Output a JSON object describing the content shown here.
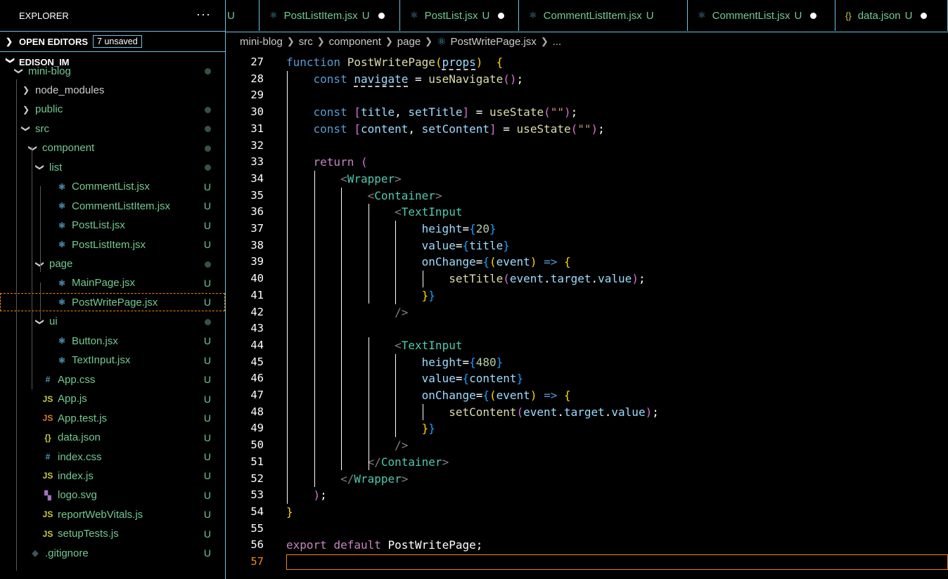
{
  "explorer": {
    "title": "EXPLORER",
    "more": "···",
    "open_editors_label": "OPEN EDITORS",
    "unsaved_badge": "7 unsaved",
    "workspace_label": "EDISON_IM"
  },
  "tree": [
    {
      "name": "mini-blog",
      "indent": 0,
      "type": "folder-open",
      "icon": "",
      "status": "dot"
    },
    {
      "name": "node_modules",
      "indent": 1,
      "type": "folder-closed",
      "icon": "",
      "status": ""
    },
    {
      "name": "public",
      "indent": 1,
      "type": "folder-closed",
      "icon": "",
      "status": "dot"
    },
    {
      "name": "src",
      "indent": 1,
      "type": "folder-open",
      "icon": "",
      "status": "dot"
    },
    {
      "name": "component",
      "indent": 2,
      "type": "folder-open",
      "icon": "",
      "status": "dot"
    },
    {
      "name": "list",
      "indent": 3,
      "type": "folder-open",
      "icon": "",
      "status": "dot"
    },
    {
      "name": "CommentList.jsx",
      "indent": 4,
      "type": "file",
      "icon": "react",
      "status": "U"
    },
    {
      "name": "CommentListItem.jsx",
      "indent": 4,
      "type": "file",
      "icon": "react",
      "status": "U"
    },
    {
      "name": "PostList.jsx",
      "indent": 4,
      "type": "file",
      "icon": "react",
      "status": "U"
    },
    {
      "name": "PostListItem.jsx",
      "indent": 4,
      "type": "file",
      "icon": "react",
      "status": "U"
    },
    {
      "name": "page",
      "indent": 3,
      "type": "folder-open",
      "icon": "",
      "status": "dot"
    },
    {
      "name": "MainPage.jsx",
      "indent": 4,
      "type": "file",
      "icon": "react",
      "status": "U"
    },
    {
      "name": "PostWritePage.jsx",
      "indent": 4,
      "type": "file",
      "icon": "react",
      "status": "U",
      "selected": true
    },
    {
      "name": "ui",
      "indent": 3,
      "type": "folder-open",
      "icon": "",
      "status": "dot"
    },
    {
      "name": "Button.jsx",
      "indent": 4,
      "type": "file",
      "icon": "react",
      "status": "U"
    },
    {
      "name": "TextInput.jsx",
      "indent": 4,
      "type": "file",
      "icon": "react",
      "status": "U"
    },
    {
      "name": "App.css",
      "indent": 2,
      "type": "file",
      "icon": "css",
      "status": "U"
    },
    {
      "name": "App.js",
      "indent": 2,
      "type": "file",
      "icon": "js",
      "status": "U"
    },
    {
      "name": "App.test.js",
      "indent": 2,
      "type": "file",
      "icon": "js-test",
      "status": "U"
    },
    {
      "name": "data.json",
      "indent": 2,
      "type": "file",
      "icon": "json",
      "status": "U"
    },
    {
      "name": "index.css",
      "indent": 2,
      "type": "file",
      "icon": "css",
      "status": "U"
    },
    {
      "name": "index.js",
      "indent": 2,
      "type": "file",
      "icon": "js",
      "status": "U"
    },
    {
      "name": "logo.svg",
      "indent": 2,
      "type": "file",
      "icon": "svg",
      "status": "U"
    },
    {
      "name": "reportWebVitals.js",
      "indent": 2,
      "type": "file",
      "icon": "js",
      "status": "U"
    },
    {
      "name": "setupTests.js",
      "indent": 2,
      "type": "file",
      "icon": "js",
      "status": "U"
    },
    {
      "name": ".gitignore",
      "indent": 1,
      "type": "file",
      "icon": "git",
      "status": "U"
    }
  ],
  "tabs": [
    {
      "label": "",
      "status": "U",
      "dirty": false,
      "icon": ""
    },
    {
      "label": "PostListItem.jsx",
      "status": "U",
      "dirty": true,
      "icon": "react"
    },
    {
      "label": "PostList.jsx",
      "status": "U",
      "dirty": true,
      "icon": "react"
    },
    {
      "label": "CommentListItem.jsx",
      "status": "U",
      "dirty": false,
      "icon": "react"
    },
    {
      "label": "CommentList.jsx",
      "status": "U",
      "dirty": true,
      "icon": "react"
    },
    {
      "label": "data.json",
      "status": "U",
      "dirty": true,
      "icon": "json"
    }
  ],
  "breadcrumb": [
    "mini-blog",
    "src",
    "component",
    "page",
    "PostWritePage.jsx",
    "..."
  ],
  "editor": {
    "current_line": 57,
    "lines": [
      {
        "n": 27,
        "tokens": [
          [
            "kw",
            "function "
          ],
          [
            "fn",
            "PostWritePage"
          ],
          [
            "b1",
            "("
          ],
          [
            "var squig",
            "props"
          ],
          [
            "b1",
            ")"
          ],
          [
            "",
            "  "
          ],
          [
            "b1",
            "{"
          ]
        ]
      },
      {
        "n": 28,
        "tokens": [
          [
            "",
            "    "
          ],
          [
            "kw",
            "const "
          ],
          [
            "var squig",
            "navigate"
          ],
          [
            "",
            " = "
          ],
          [
            "fn",
            "useNavigate"
          ],
          [
            "b2",
            "()"
          ],
          [
            "",
            ";"
          ]
        ]
      },
      {
        "n": 29,
        "tokens": []
      },
      {
        "n": 30,
        "tokens": [
          [
            "",
            "    "
          ],
          [
            "kw",
            "const "
          ],
          [
            "b2",
            "["
          ],
          [
            "var",
            "title"
          ],
          [
            "",
            ", "
          ],
          [
            "var",
            "setTitle"
          ],
          [
            "b2",
            "]"
          ],
          [
            "",
            " = "
          ],
          [
            "fn",
            "useState"
          ],
          [
            "b2",
            "("
          ],
          [
            "str",
            "\"\""
          ],
          [
            "b2",
            ")"
          ],
          [
            "",
            ";"
          ]
        ]
      },
      {
        "n": 31,
        "tokens": [
          [
            "",
            "    "
          ],
          [
            "kw",
            "const "
          ],
          [
            "b2",
            "["
          ],
          [
            "var",
            "content"
          ],
          [
            "",
            ", "
          ],
          [
            "var",
            "setContent"
          ],
          [
            "b2",
            "]"
          ],
          [
            "",
            " = "
          ],
          [
            "fn",
            "useState"
          ],
          [
            "b2",
            "("
          ],
          [
            "str",
            "\"\""
          ],
          [
            "b2",
            ")"
          ],
          [
            "",
            ";"
          ]
        ]
      },
      {
        "n": 32,
        "tokens": []
      },
      {
        "n": 33,
        "tokens": [
          [
            "",
            "    "
          ],
          [
            "kw2",
            "return "
          ],
          [
            "b2",
            "("
          ]
        ]
      },
      {
        "n": 34,
        "tokens": [
          [
            "",
            "        "
          ],
          [
            "pun",
            "<"
          ],
          [
            "tag",
            "Wrapper"
          ],
          [
            "pun",
            ">"
          ]
        ]
      },
      {
        "n": 35,
        "tokens": [
          [
            "",
            "            "
          ],
          [
            "pun",
            "<"
          ],
          [
            "tag",
            "Container"
          ],
          [
            "pun",
            ">"
          ]
        ]
      },
      {
        "n": 36,
        "tokens": [
          [
            "",
            "                "
          ],
          [
            "pun",
            "<"
          ],
          [
            "tag",
            "TextInput"
          ]
        ]
      },
      {
        "n": 37,
        "tokens": [
          [
            "",
            "                    "
          ],
          [
            "var",
            "height"
          ],
          [
            "",
            "="
          ],
          [
            "b3",
            "{"
          ],
          [
            "num",
            "20"
          ],
          [
            "b3",
            "}"
          ]
        ]
      },
      {
        "n": 38,
        "tokens": [
          [
            "",
            "                    "
          ],
          [
            "var",
            "value"
          ],
          [
            "",
            "="
          ],
          [
            "b3",
            "{"
          ],
          [
            "var",
            "title"
          ],
          [
            "b3",
            "}"
          ]
        ]
      },
      {
        "n": 39,
        "tokens": [
          [
            "",
            "                    "
          ],
          [
            "var",
            "onChange"
          ],
          [
            "",
            "="
          ],
          [
            "b3",
            "{"
          ],
          [
            "b1",
            "("
          ],
          [
            "var",
            "event"
          ],
          [
            "b1",
            ")"
          ],
          [
            "",
            " "
          ],
          [
            "kw",
            "=>"
          ],
          [
            "",
            " "
          ],
          [
            "b1",
            "{"
          ]
        ]
      },
      {
        "n": 40,
        "tokens": [
          [
            "",
            "                        "
          ],
          [
            "fn",
            "setTitle"
          ],
          [
            "b2",
            "("
          ],
          [
            "var",
            "event"
          ],
          [
            "",
            "."
          ],
          [
            "var",
            "target"
          ],
          [
            "",
            "."
          ],
          [
            "var",
            "value"
          ],
          [
            "b2",
            ")"
          ],
          [
            "",
            ";"
          ]
        ]
      },
      {
        "n": 41,
        "tokens": [
          [
            "",
            "                    "
          ],
          [
            "b1",
            "}"
          ],
          [
            "b3",
            "}"
          ]
        ]
      },
      {
        "n": 42,
        "tokens": [
          [
            "",
            "                "
          ],
          [
            "pun",
            "/>"
          ]
        ]
      },
      {
        "n": 43,
        "tokens": []
      },
      {
        "n": 44,
        "tokens": [
          [
            "",
            "                "
          ],
          [
            "pun",
            "<"
          ],
          [
            "tag",
            "TextInput"
          ]
        ]
      },
      {
        "n": 45,
        "tokens": [
          [
            "",
            "                    "
          ],
          [
            "var",
            "height"
          ],
          [
            "",
            "="
          ],
          [
            "b3",
            "{"
          ],
          [
            "num",
            "480"
          ],
          [
            "b3",
            "}"
          ]
        ]
      },
      {
        "n": 46,
        "tokens": [
          [
            "",
            "                    "
          ],
          [
            "var",
            "value"
          ],
          [
            "",
            "="
          ],
          [
            "b3",
            "{"
          ],
          [
            "var",
            "content"
          ],
          [
            "b3",
            "}"
          ]
        ]
      },
      {
        "n": 47,
        "tokens": [
          [
            "",
            "                    "
          ],
          [
            "var",
            "onChange"
          ],
          [
            "",
            "="
          ],
          [
            "b3",
            "{"
          ],
          [
            "b1",
            "("
          ],
          [
            "var",
            "event"
          ],
          [
            "b1",
            ")"
          ],
          [
            "",
            " "
          ],
          [
            "kw",
            "=>"
          ],
          [
            "",
            " "
          ],
          [
            "b1",
            "{"
          ]
        ]
      },
      {
        "n": 48,
        "tokens": [
          [
            "",
            "                        "
          ],
          [
            "fn",
            "setContent"
          ],
          [
            "b2",
            "("
          ],
          [
            "var",
            "event"
          ],
          [
            "",
            "."
          ],
          [
            "var",
            "target"
          ],
          [
            "",
            "."
          ],
          [
            "var",
            "value"
          ],
          [
            "b2",
            ")"
          ],
          [
            "",
            ";"
          ]
        ]
      },
      {
        "n": 49,
        "tokens": [
          [
            "",
            "                    "
          ],
          [
            "b1",
            "}"
          ],
          [
            "b3",
            "}"
          ]
        ]
      },
      {
        "n": 50,
        "tokens": [
          [
            "",
            "                "
          ],
          [
            "pun",
            "/>"
          ]
        ]
      },
      {
        "n": 51,
        "tokens": [
          [
            "",
            "            "
          ],
          [
            "pun",
            "</"
          ],
          [
            "tag",
            "Container"
          ],
          [
            "pun",
            ">"
          ]
        ]
      },
      {
        "n": 52,
        "tokens": [
          [
            "",
            "        "
          ],
          [
            "pun",
            "</"
          ],
          [
            "tag",
            "Wrapper"
          ],
          [
            "pun",
            ">"
          ]
        ]
      },
      {
        "n": 53,
        "tokens": [
          [
            "",
            "    "
          ],
          [
            "b2",
            ")"
          ],
          [
            "",
            ";"
          ]
        ]
      },
      {
        "n": 54,
        "tokens": [
          [
            "b1",
            "}"
          ]
        ]
      },
      {
        "n": 55,
        "tokens": []
      },
      {
        "n": 56,
        "tokens": [
          [
            "kw2",
            "export "
          ],
          [
            "kw2",
            "default "
          ],
          [
            "",
            "PostWritePage;"
          ]
        ]
      },
      {
        "n": 57,
        "tokens": []
      }
    ]
  },
  "colors": {
    "border": "#6fc3df",
    "untracked": "#73c991",
    "accent": "#f38518"
  }
}
